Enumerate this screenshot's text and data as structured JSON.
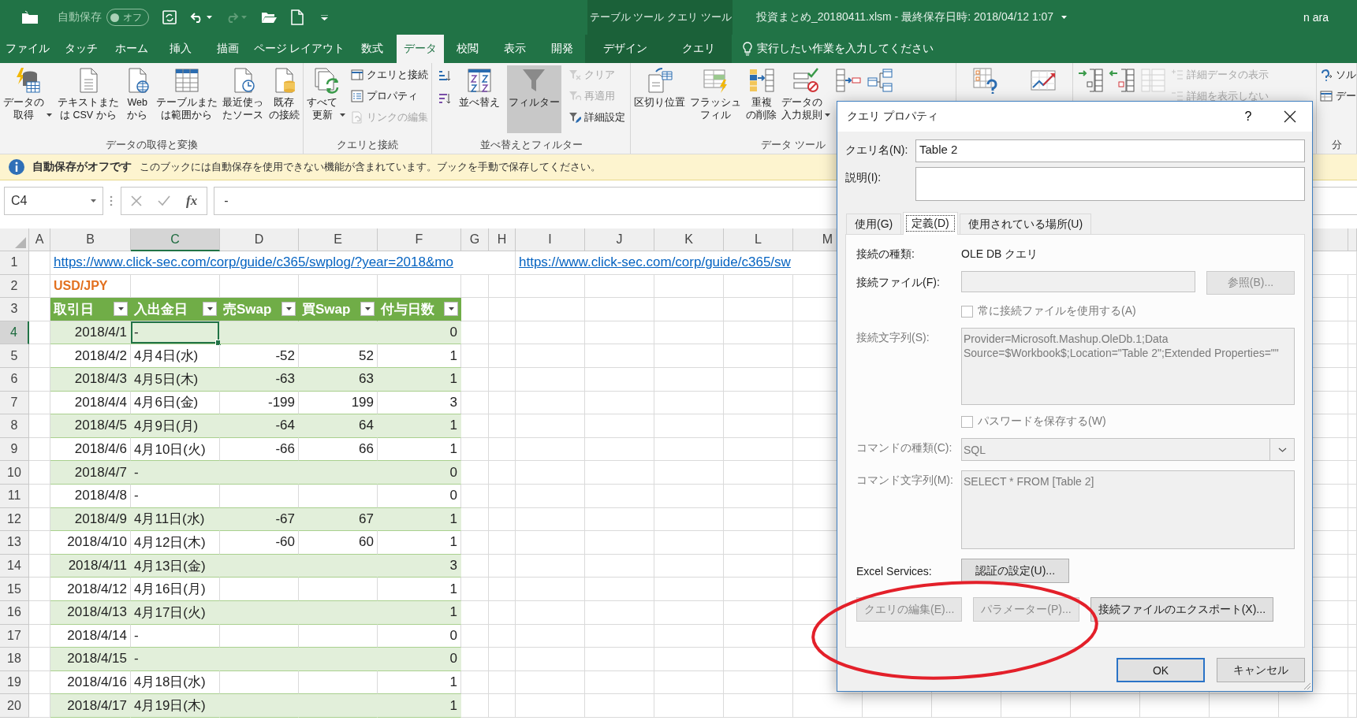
{
  "title_bar": {
    "autosave_label": "自動保存",
    "autosave_toggle": {
      "label": "オフ",
      "on": false
    },
    "context_tabs": [
      {
        "label": "テーブル ツール"
      },
      {
        "label": "クエリ ツール"
      }
    ],
    "document_title": "投資まとめ_20180411.xlsm - 最終保存日時: 2018/04/12 1:07",
    "user": "n ara"
  },
  "ribbon_tabs": [
    {
      "label": "ファイル",
      "kind": "plain",
      "selected": false
    },
    {
      "label": "タッチ",
      "kind": "plain",
      "selected": false
    },
    {
      "label": "ホーム",
      "kind": "plain",
      "selected": false
    },
    {
      "label": "挿入",
      "kind": "plain",
      "selected": false
    },
    {
      "label": "描画",
      "kind": "plain",
      "selected": false
    },
    {
      "label": "ページ レイアウト",
      "kind": "plain",
      "selected": false
    },
    {
      "label": "数式",
      "kind": "plain",
      "selected": false
    },
    {
      "label": "データ",
      "kind": "plain",
      "selected": true
    },
    {
      "label": "校閲",
      "kind": "plain",
      "selected": false
    },
    {
      "label": "表示",
      "kind": "plain",
      "selected": false
    },
    {
      "label": "開発",
      "kind": "plain",
      "selected": false
    },
    {
      "label": "デザイン",
      "kind": "context",
      "selected": false
    },
    {
      "label": "クエリ",
      "kind": "context",
      "selected": false
    }
  ],
  "tell_me": {
    "placeholder": "実行したい作業を入力してください"
  },
  "ribbon_groups": [
    {
      "label": "データの取得と変換",
      "items": [
        {
          "kind": "large",
          "lines": [
            "データの",
            "取得"
          ],
          "menu": true,
          "disabled": false,
          "on": false
        },
        {
          "kind": "large",
          "lines": [
            "テキストまた",
            "は CSV から"
          ],
          "menu": false,
          "disabled": false,
          "on": false
        },
        {
          "kind": "large",
          "lines": [
            "Web",
            "から"
          ],
          "menu": false,
          "disabled": false,
          "on": false
        },
        {
          "kind": "large",
          "lines": [
            "テーブルまた",
            "は範囲から"
          ],
          "menu": false,
          "disabled": false,
          "on": false
        },
        {
          "kind": "large",
          "lines": [
            "最近使っ",
            "たソース"
          ],
          "menu": false,
          "disabled": false,
          "on": false
        },
        {
          "kind": "large",
          "lines": [
            "既存",
            "の接続"
          ],
          "menu": false,
          "disabled": false,
          "on": false
        }
      ]
    },
    {
      "label": "クエリと接続",
      "items": [
        {
          "kind": "large",
          "lines": [
            "すべて",
            "更新"
          ],
          "menu": true,
          "disabled": false,
          "on": false
        },
        {
          "kind": "small",
          "label": "クエリと接続",
          "menu": false,
          "disabled": false,
          "on": false
        },
        {
          "kind": "small",
          "label": "プロパティ",
          "menu": false,
          "disabled": false,
          "on": false
        },
        {
          "kind": "small",
          "label": "リンクの編集",
          "menu": false,
          "disabled": true,
          "on": false
        }
      ]
    },
    {
      "label": "並べ替えとフィルター",
      "items": [
        {
          "kind": "icon",
          "menu": false,
          "disabled": false,
          "on": false
        },
        {
          "kind": "icon",
          "menu": false,
          "disabled": false,
          "on": false
        },
        {
          "kind": "large",
          "lines": [
            "並べ替え"
          ],
          "menu": false,
          "disabled": false,
          "on": false
        },
        {
          "kind": "large",
          "lines": [
            "フィルター"
          ],
          "menu": false,
          "disabled": false,
          "on": true
        },
        {
          "kind": "small",
          "label": "クリア",
          "menu": false,
          "disabled": true,
          "on": false
        },
        {
          "kind": "small",
          "label": "再適用",
          "menu": false,
          "disabled": true,
          "on": false
        },
        {
          "kind": "small",
          "label": "詳細設定",
          "menu": false,
          "disabled": false,
          "on": false
        }
      ]
    },
    {
      "label": "データ ツール",
      "items": [
        {
          "kind": "large",
          "lines": [
            "区切り位置"
          ],
          "menu": false,
          "disabled": false,
          "on": false
        },
        {
          "kind": "large",
          "lines": [
            "フラッシュ",
            "フィル"
          ],
          "menu": false,
          "disabled": false,
          "on": false
        },
        {
          "kind": "large",
          "lines": [
            "重複",
            "の削除"
          ],
          "menu": false,
          "disabled": false,
          "on": false
        },
        {
          "kind": "large",
          "lines": [
            "データの",
            "入力規則"
          ],
          "menu": true,
          "disabled": false,
          "on": false
        },
        {
          "kind": "large",
          "menu": false,
          "disabled": false,
          "on": false
        },
        {
          "kind": "large",
          "menu": false,
          "disabled": false,
          "on": false
        }
      ]
    },
    {
      "items": [
        {
          "kind": "large",
          "menu": false,
          "disabled": false,
          "on": false
        },
        {
          "kind": "large",
          "menu": false,
          "disabled": false,
          "on": false
        }
      ]
    },
    {
      "items": [
        {
          "kind": "large",
          "menu": false,
          "disabled": false,
          "on": false
        },
        {
          "kind": "large",
          "menu": false,
          "disabled": false,
          "on": false
        },
        {
          "kind": "large",
          "menu": false,
          "disabled": true,
          "on": false
        },
        {
          "kind": "small",
          "label": "詳細データの表示",
          "menu": false,
          "disabled": true,
          "on": false
        },
        {
          "kind": "small",
          "label": "詳細を表示しない",
          "menu": false,
          "disabled": true,
          "on": false
        }
      ]
    },
    {
      "label": "分",
      "items": [
        {
          "kind": "small",
          "label": "ソル",
          "menu": false,
          "disabled": false,
          "on": false
        },
        {
          "kind": "small",
          "label": "デー",
          "menu": false,
          "disabled": false,
          "on": false
        }
      ]
    }
  ],
  "message_bar": {
    "title": "自動保存がオフです",
    "text": "このブックには自動保存を使用できない機能が含まれています。ブックを手動で保存してください。"
  },
  "formula_bar": {
    "name_box": "C4",
    "function_label": "fx",
    "formula": "-"
  },
  "sheet": {
    "columns": [
      {
        "label": "A",
        "selected": false
      },
      {
        "label": "B",
        "selected": false
      },
      {
        "label": "C",
        "selected": true
      },
      {
        "label": "D",
        "selected": false
      },
      {
        "label": "E",
        "selected": false
      },
      {
        "label": "F",
        "selected": false
      },
      {
        "label": "G",
        "selected": false
      },
      {
        "label": "H",
        "selected": false
      },
      {
        "label": "I",
        "selected": false
      },
      {
        "label": "J",
        "selected": false
      },
      {
        "label": "K",
        "selected": false
      },
      {
        "label": "L",
        "selected": false
      },
      {
        "label": "M",
        "selected": false
      }
    ],
    "rows": [
      {
        "number": "1",
        "selected": false,
        "kind": "links",
        "links": [
          "https://www.click-sec.com/corp/guide/c365/swplog/?year=2018&mo",
          "https://www.click-sec.com/corp/guide/c365/sw"
        ]
      },
      {
        "number": "2",
        "selected": false,
        "kind": "title",
        "text": "USD/JPY"
      },
      {
        "number": "3",
        "selected": false,
        "kind": "header",
        "headers": [
          "取引日",
          "入出金日",
          "売Swap",
          "買Swap",
          "付与日数"
        ]
      },
      {
        "number": "4",
        "selected": true,
        "kind": "data",
        "banded": true,
        "cells": [
          {
            "text": "2018/4/1",
            "selected": false
          },
          {
            "text": "-",
            "selected": true
          },
          {
            "selected": false
          },
          {
            "selected": false
          },
          {
            "text": "0",
            "selected": false
          }
        ]
      },
      {
        "number": "5",
        "selected": false,
        "kind": "data",
        "banded": false,
        "cells": [
          {
            "text": "2018/4/2",
            "selected": false
          },
          {
            "text": "4月4日(水)",
            "selected": false
          },
          {
            "text": "-52",
            "selected": false
          },
          {
            "text": "52",
            "selected": false
          },
          {
            "text": "1",
            "selected": false
          }
        ]
      },
      {
        "number": "6",
        "selected": false,
        "kind": "data",
        "banded": true,
        "cells": [
          {
            "text": "2018/4/3",
            "selected": false
          },
          {
            "text": "4月5日(木)",
            "selected": false
          },
          {
            "text": "-63",
            "selected": false
          },
          {
            "text": "63",
            "selected": false
          },
          {
            "text": "1",
            "selected": false
          }
        ]
      },
      {
        "number": "7",
        "selected": false,
        "kind": "data",
        "banded": false,
        "cells": [
          {
            "text": "2018/4/4",
            "selected": false
          },
          {
            "text": "4月6日(金)",
            "selected": false
          },
          {
            "text": "-199",
            "selected": false
          },
          {
            "text": "199",
            "selected": false
          },
          {
            "text": "3",
            "selected": false
          }
        ]
      },
      {
        "number": "8",
        "selected": false,
        "kind": "data",
        "banded": true,
        "cells": [
          {
            "text": "2018/4/5",
            "selected": false
          },
          {
            "text": "4月9日(月)",
            "selected": false
          },
          {
            "text": "-64",
            "selected": false
          },
          {
            "text": "64",
            "selected": false
          },
          {
            "text": "1",
            "selected": false
          }
        ]
      },
      {
        "number": "9",
        "selected": false,
        "kind": "data",
        "banded": false,
        "cells": [
          {
            "text": "2018/4/6",
            "selected": false
          },
          {
            "text": "4月10日(火)",
            "selected": false
          },
          {
            "text": "-66",
            "selected": false
          },
          {
            "text": "66",
            "selected": false
          },
          {
            "text": "1",
            "selected": false
          }
        ]
      },
      {
        "number": "10",
        "selected": false,
        "kind": "data",
        "banded": true,
        "cells": [
          {
            "text": "2018/4/7",
            "selected": false
          },
          {
            "text": "-",
            "selected": false
          },
          {
            "selected": false
          },
          {
            "selected": false
          },
          {
            "text": "0",
            "selected": false
          }
        ]
      },
      {
        "number": "11",
        "selected": false,
        "kind": "data",
        "banded": false,
        "cells": [
          {
            "text": "2018/4/8",
            "selected": false
          },
          {
            "text": "-",
            "selected": false
          },
          {
            "selected": false
          },
          {
            "selected": false
          },
          {
            "text": "0",
            "selected": false
          }
        ]
      },
      {
        "number": "12",
        "selected": false,
        "kind": "data",
        "banded": true,
        "cells": [
          {
            "text": "2018/4/9",
            "selected": false
          },
          {
            "text": "4月11日(水)",
            "selected": false
          },
          {
            "text": "-67",
            "selected": false
          },
          {
            "text": "67",
            "selected": false
          },
          {
            "text": "1",
            "selected": false
          }
        ]
      },
      {
        "number": "13",
        "selected": false,
        "kind": "data",
        "banded": false,
        "cells": [
          {
            "text": "2018/4/10",
            "selected": false
          },
          {
            "text": "4月12日(木)",
            "selected": false
          },
          {
            "text": "-60",
            "selected": false
          },
          {
            "text": "60",
            "selected": false
          },
          {
            "text": "1",
            "selected": false
          }
        ]
      },
      {
        "number": "14",
        "selected": false,
        "kind": "data",
        "banded": true,
        "cells": [
          {
            "text": "2018/4/11",
            "selected": false
          },
          {
            "text": "4月13日(金)",
            "selected": false
          },
          {
            "selected": false
          },
          {
            "selected": false
          },
          {
            "text": "3",
            "selected": false
          }
        ]
      },
      {
        "number": "15",
        "selected": false,
        "kind": "data",
        "banded": false,
        "cells": [
          {
            "text": "2018/4/12",
            "selected": false
          },
          {
            "text": "4月16日(月)",
            "selected": false
          },
          {
            "selected": false
          },
          {
            "selected": false
          },
          {
            "text": "1",
            "selected": false
          }
        ]
      },
      {
        "number": "16",
        "selected": false,
        "kind": "data",
        "banded": true,
        "cells": [
          {
            "text": "2018/4/13",
            "selected": false
          },
          {
            "text": "4月17日(火)",
            "selected": false
          },
          {
            "selected": false
          },
          {
            "selected": false
          },
          {
            "text": "1",
            "selected": false
          }
        ]
      },
      {
        "number": "17",
        "selected": false,
        "kind": "data",
        "banded": false,
        "cells": [
          {
            "text": "2018/4/14",
            "selected": false
          },
          {
            "text": "-",
            "selected": false
          },
          {
            "selected": false
          },
          {
            "selected": false
          },
          {
            "text": "0",
            "selected": false
          }
        ]
      },
      {
        "number": "18",
        "selected": false,
        "kind": "data",
        "banded": true,
        "cells": [
          {
            "text": "2018/4/15",
            "selected": false
          },
          {
            "text": "-",
            "selected": false
          },
          {
            "selected": false
          },
          {
            "selected": false
          },
          {
            "text": "0",
            "selected": false
          }
        ]
      },
      {
        "number": "19",
        "selected": false,
        "kind": "data",
        "banded": false,
        "cells": [
          {
            "text": "2018/4/16",
            "selected": false
          },
          {
            "text": "4月18日(水)",
            "selected": false
          },
          {
            "selected": false
          },
          {
            "selected": false
          },
          {
            "text": "1",
            "selected": false
          }
        ]
      },
      {
        "number": "20",
        "selected": false,
        "kind": "data",
        "banded": true,
        "cells": [
          {
            "text": "2018/4/17",
            "selected": false
          },
          {
            "text": "4月19日(木)",
            "selected": false
          },
          {
            "selected": false
          },
          {
            "selected": false
          },
          {
            "text": "1",
            "selected": false
          }
        ]
      }
    ]
  },
  "dialog": {
    "title": "クエリ プロパティ",
    "help": "?",
    "name_label": "クエリ名(N):",
    "name_value": "Table 2",
    "description_label": "説明(I):",
    "tabs": [
      {
        "label": "使用(G)",
        "selected": false
      },
      {
        "label": "定義(D)",
        "selected": true
      },
      {
        "label": "使用されている場所(U)",
        "selected": false
      }
    ],
    "fields": [
      {
        "kind": "text",
        "label": "接続の種類:",
        "value": "OLE DB クエリ",
        "disabled": false
      },
      {
        "kind": "file",
        "label": "接続ファイル(F):",
        "button": "参照(B)...",
        "disabled": true
      },
      {
        "kind": "checkbox",
        "label": "常に接続ファイルを使用する(A)",
        "checked": false,
        "disabled": true
      },
      {
        "kind": "textarea",
        "label": "接続文字列(S):",
        "value": "Provider=Microsoft.Mashup.OleDb.1;Data Source=$Workbook$;Location=\"Table 2\";Extended Properties=\"\"",
        "disabled": true
      },
      {
        "kind": "checkbox",
        "label": "パスワードを保存する(W)",
        "checked": false,
        "disabled": true
      },
      {
        "kind": "select",
        "label": "コマンドの種類(C):",
        "value": "SQL",
        "disabled": true
      },
      {
        "kind": "textarea",
        "label": "コマンド文字列(M):",
        "value": "SELECT * FROM [Table 2]",
        "disabled": true
      },
      {
        "kind": "button",
        "label": "Excel Services:",
        "button": "認証の設定(U)...",
        "disabled": false
      }
    ],
    "action_buttons": [
      {
        "label": "クエリの編集(E)...",
        "disabled": true
      },
      {
        "label": "パラメーター(P)...",
        "disabled": true
      },
      {
        "label": "接続ファイルのエクスポート(X)...",
        "disabled": false
      }
    ],
    "buttons": [
      {
        "label": "OK",
        "default": true
      },
      {
        "label": "キャンセル",
        "default": false
      }
    ]
  },
  "annotation": {
    "kind": "ellipse"
  }
}
